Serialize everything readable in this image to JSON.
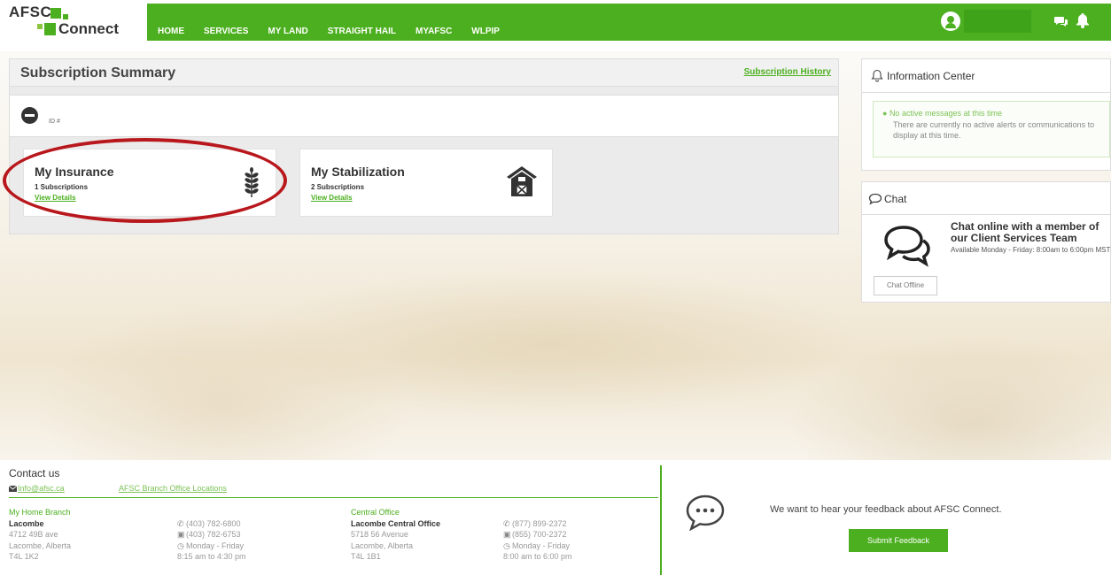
{
  "brand": {
    "line1": "AFSC",
    "line2": "Connect",
    "green": "#4caf1f"
  },
  "nav": {
    "items": [
      "HOME",
      "SERVICES",
      "MY LAND",
      "STRAIGHT HAIL",
      "MYAFSC",
      "WLPIP"
    ]
  },
  "header": {
    "user_icon": "user-circle-icon",
    "chat_icon": "chat-bubbles-icon",
    "bell_icon": "bell-icon"
  },
  "subscription": {
    "title": "Subscription Summary",
    "history_link": "Subscription History",
    "account": {
      "id_label": "ID #"
    },
    "cards": [
      {
        "title": "My Insurance",
        "count": "1 Subscriptions",
        "link": "View Details",
        "icon": "wheat-icon"
      },
      {
        "title": "My Stabilization",
        "count": "2 Subscriptions",
        "link": "View Details",
        "icon": "barn-icon"
      }
    ]
  },
  "info_center": {
    "title": "Information Center",
    "message_title": "No active messages at this time",
    "message_body": "There are currently no active alerts or communications to display at this time."
  },
  "chat": {
    "title": "Chat",
    "promo": "Chat online with a member of our Client Services Team",
    "hours": "Available Monday - Friday: 8:00am to 6:00pm MST",
    "button": "Chat Offline"
  },
  "footer": {
    "contact_title": "Contact us",
    "email": "Info@afsc.ca",
    "branch_link": "AFSC Branch Office Locations",
    "home_branch": {
      "heading": "My Home Branch",
      "name": "Lacombe",
      "address1": "4712 49B ave",
      "address2": "Lacombe, Alberta",
      "postal": "T4L 1K2",
      "phone": "(403) 782-6800",
      "fax": "(403) 782-6753",
      "days": "Monday - Friday",
      "hours": "8:15 am to 4:30 pm"
    },
    "central_office": {
      "heading": "Central Office",
      "name": "Lacombe Central Office",
      "address1": "5718 56 Avenue",
      "address2": "Lacombe, Alberta",
      "postal": "T4L 1B1",
      "phone": "(877) 899-2372",
      "fax": "(855) 700-2372",
      "days": "Monday - Friday",
      "hours": "8:00 am to 6:00 pm"
    },
    "feedback_text": "We want to hear your feedback about AFSC Connect.",
    "feedback_button": "Submit Feedback"
  }
}
